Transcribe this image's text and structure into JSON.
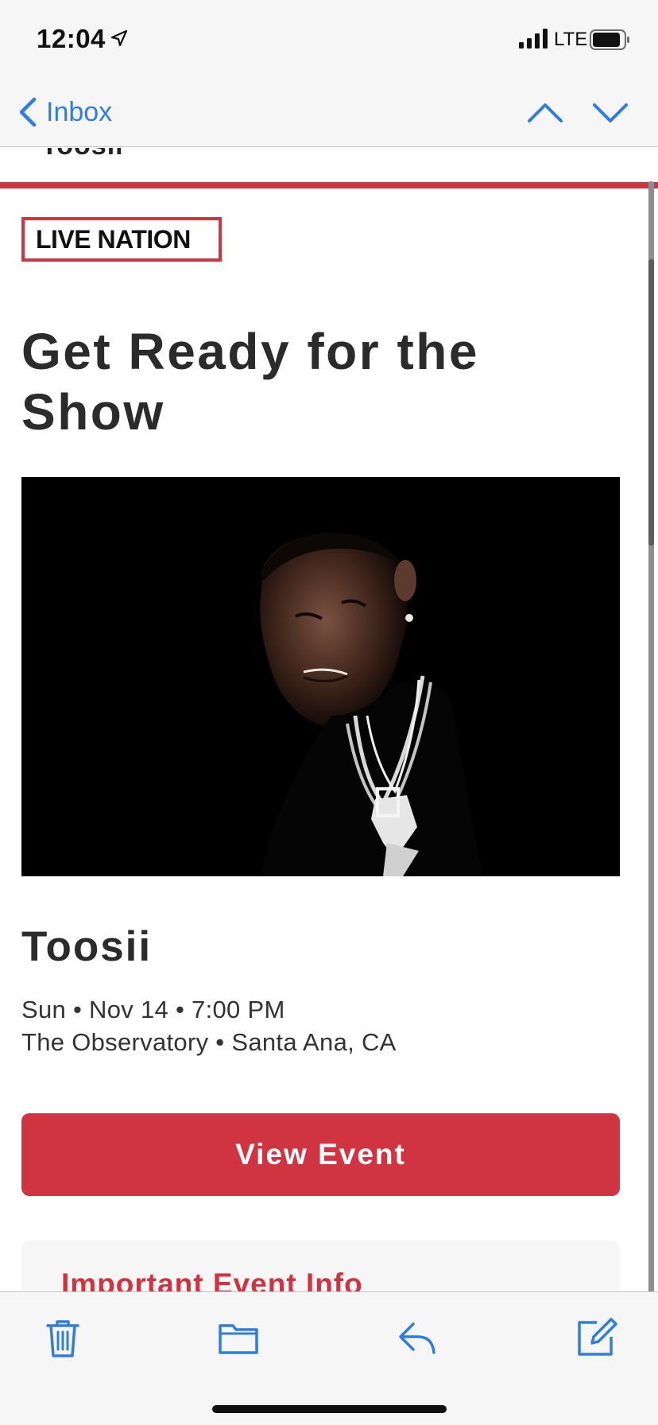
{
  "status_bar": {
    "time": "12:04",
    "network": "LTE",
    "icons": [
      "location-arrow-icon",
      "signal-bars-icon",
      "battery-icon"
    ]
  },
  "nav": {
    "back_label": "Inbox",
    "icons": [
      "chevron-left-icon",
      "chevron-up-icon",
      "chevron-down-icon"
    ]
  },
  "email": {
    "cut_off_text": "Toosii",
    "logo_text": "LIVE NATION",
    "headline": "Get Ready for the Show",
    "hero_image": "artist-photo",
    "artist": "Toosii",
    "date_line": "Sun • Nov 14 • 7:00 PM",
    "venue_line": "The Observatory • Santa Ana, CA",
    "cta_label": "View Event",
    "info_title": "Important Event Info"
  },
  "toolbar": {
    "icons": [
      "trash-icon",
      "folder-icon",
      "reply-icon",
      "compose-icon"
    ]
  },
  "colors": {
    "brand_red": "#cf3440",
    "ios_blue": "#2f7de1",
    "text_dark": "#2b2b2b"
  }
}
